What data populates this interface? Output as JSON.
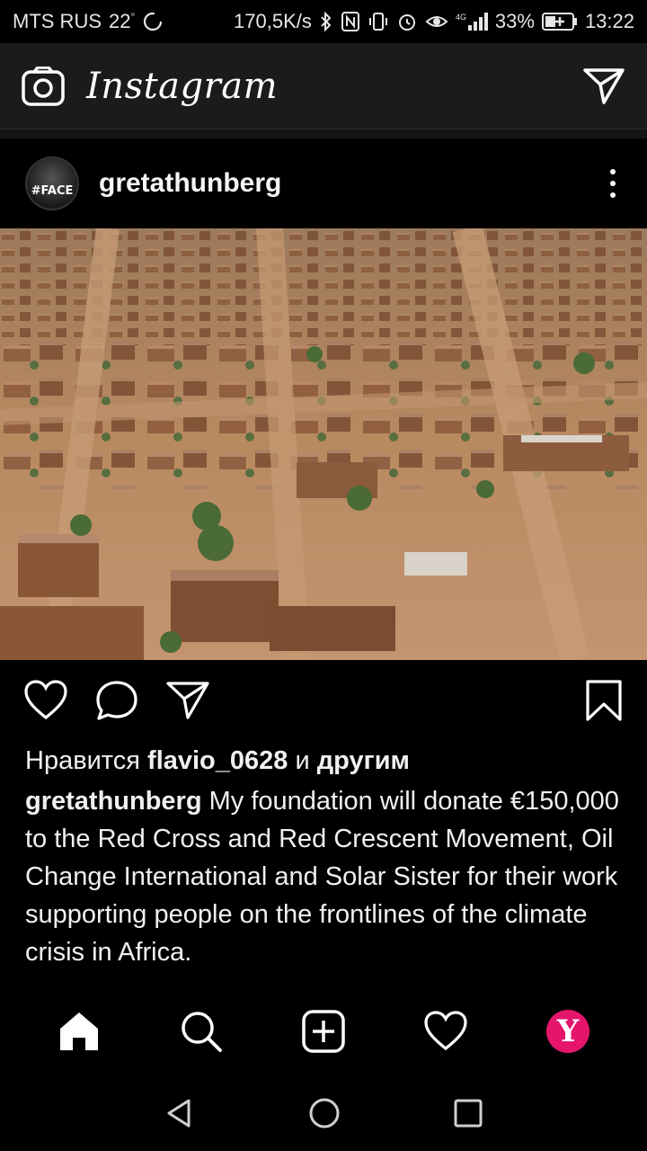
{
  "status_bar": {
    "carrier": "MTS RUS",
    "temperature": "22",
    "temp_unit": "°",
    "speed": "170,5K/s",
    "network": "4G",
    "battery": "33%",
    "time": "13:22"
  },
  "header": {
    "app_title": "Instagram"
  },
  "post": {
    "username": "gretathunberg",
    "avatar_tag": "#FACE",
    "likes_prefix": "Нравится ",
    "likes_user": "flavio_0628",
    "likes_middle": " и ",
    "likes_suffix": "другим",
    "caption_user": "gretathunberg",
    "caption_text": " My foundation will donate €150,000 to the Red Cross and Red Crescent Movement, Oil Change International and Solar Sister for their work supporting people on the frontlines of the climate crisis in Africa."
  },
  "bottom_nav": {
    "profile_letter": "Y"
  },
  "colors": {
    "profile_accent": "#e4156b",
    "header_bg": "#1b1b1b",
    "flood_water": "#b7865c"
  }
}
